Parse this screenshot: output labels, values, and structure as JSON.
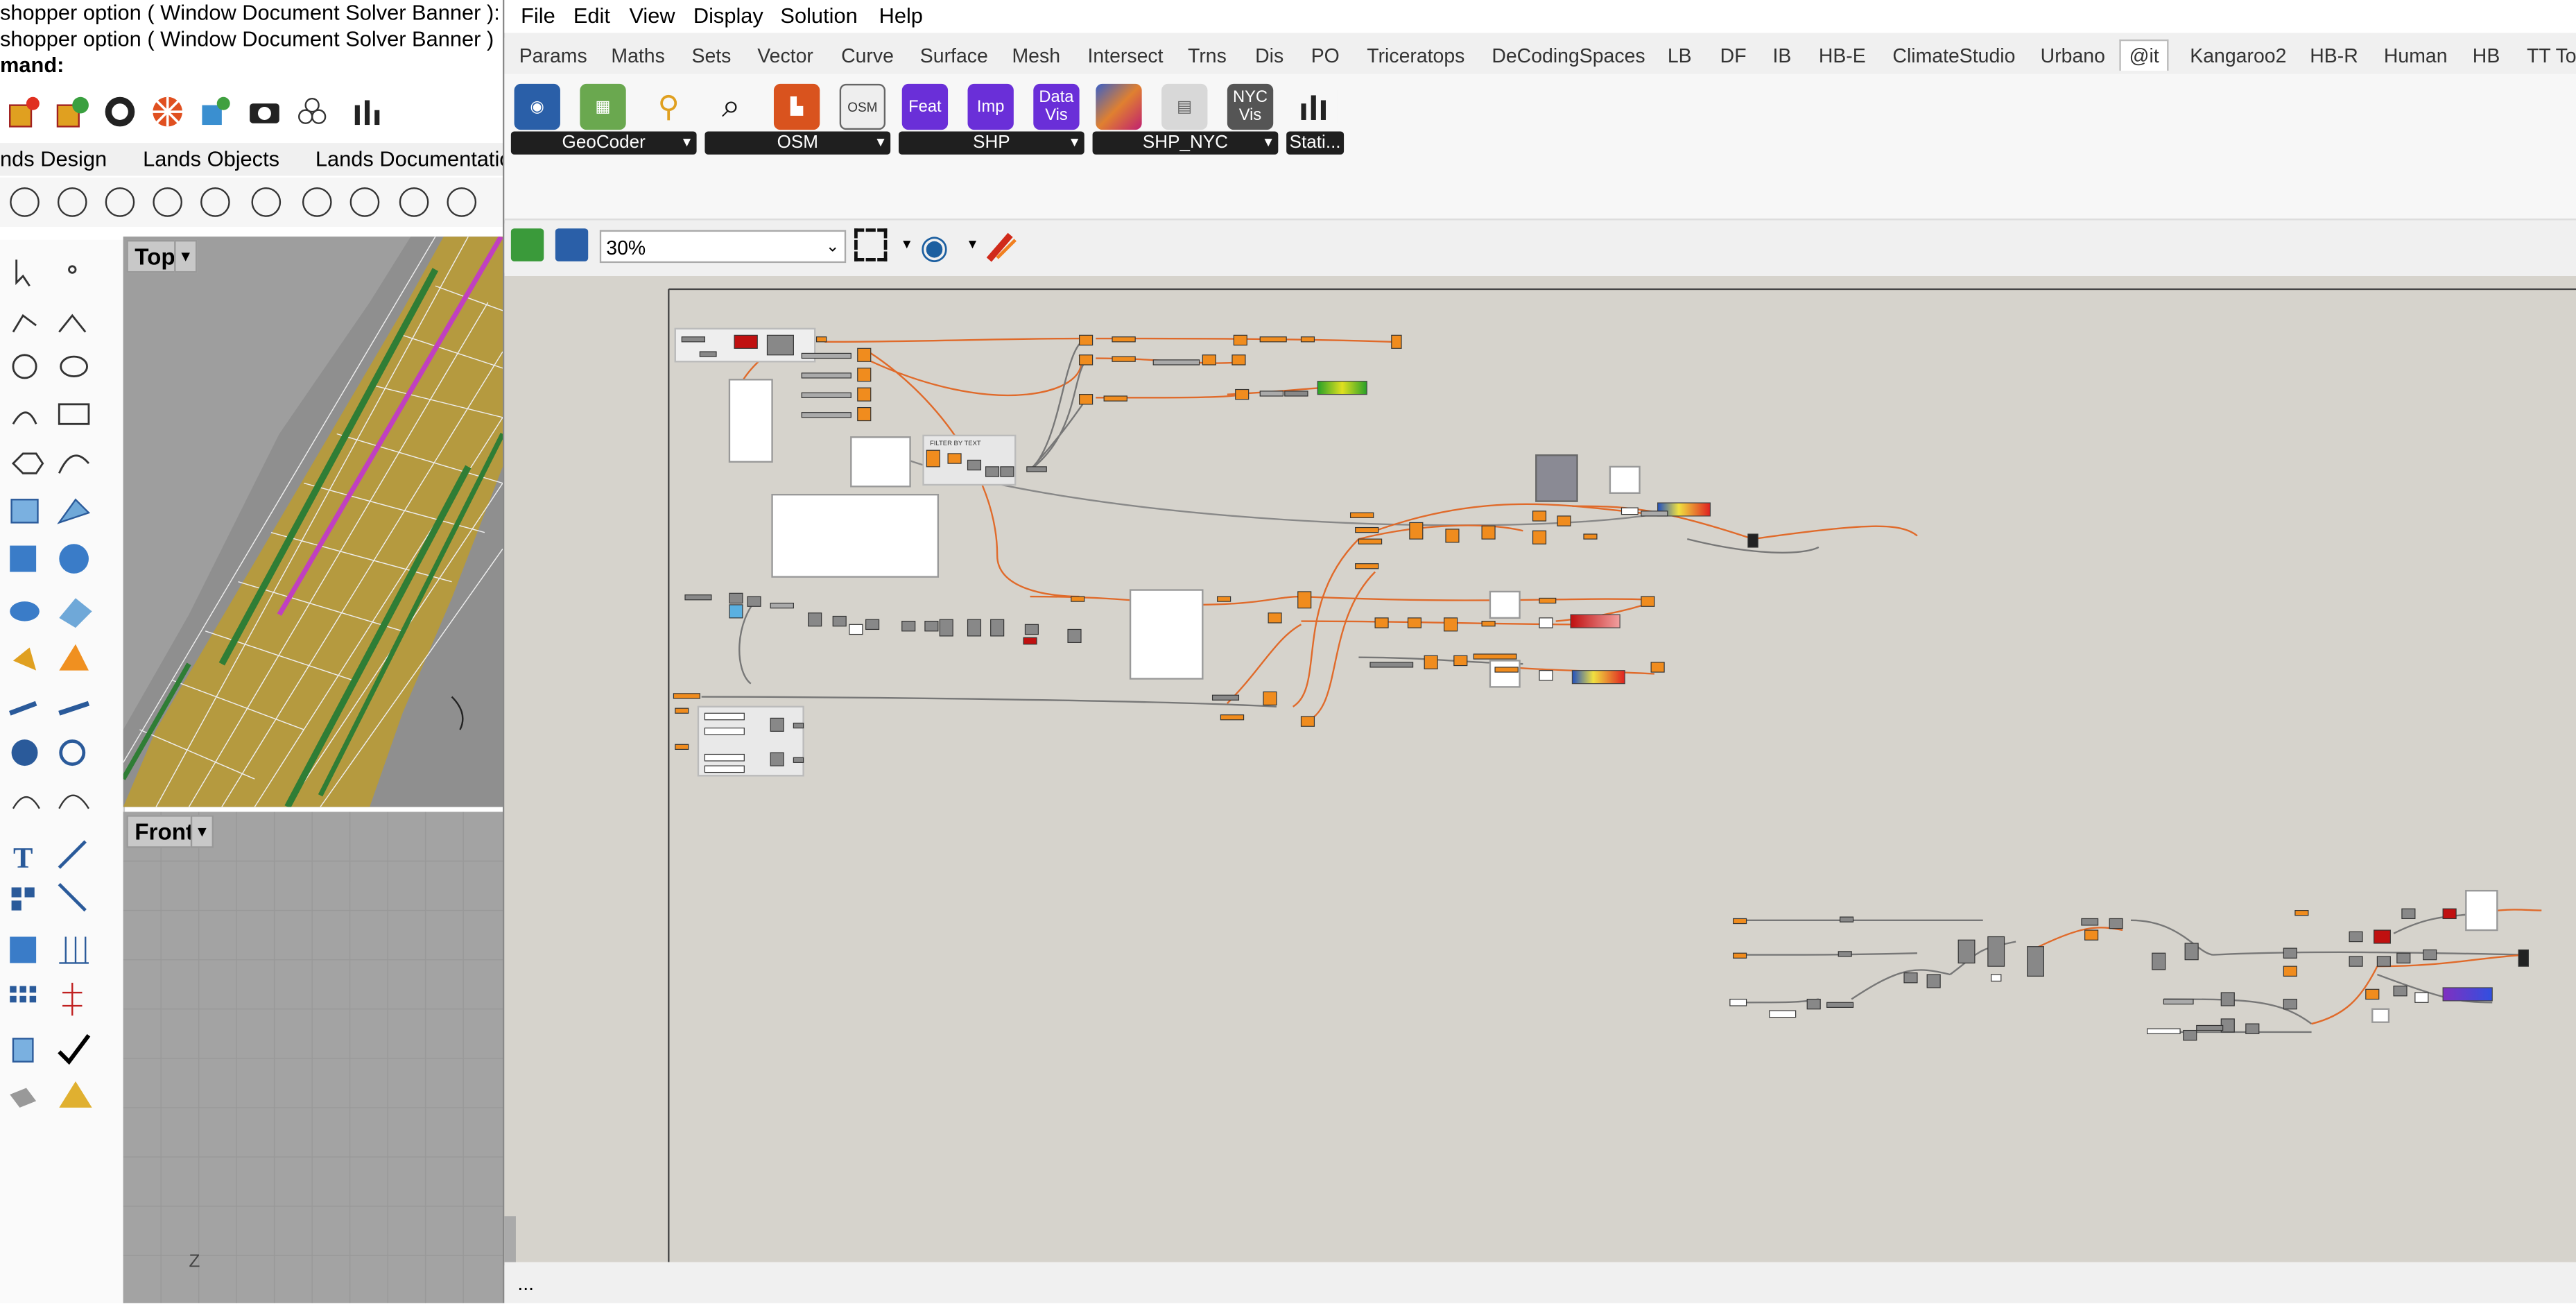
{
  "rhino": {
    "command_lines": [
      "shopper option ( Window  Document  Solver  Banner ):",
      "shopper option ( Window  Document  Solver  Banner )",
      "mand:"
    ],
    "tabs": [
      "nds Design",
      "Lands Objects",
      "Lands Documentatio"
    ],
    "viewports": {
      "top": "Top",
      "front": "Front"
    },
    "axis_label": "Z"
  },
  "gh": {
    "menu": [
      "File",
      "Edit",
      "View",
      "Display",
      "Solution",
      "Help"
    ],
    "tabs": [
      "Params",
      "Maths",
      "Sets",
      "Vector",
      "Curve",
      "Surface",
      "Mesh",
      "Intersect",
      "Trns",
      "Dis",
      "PO",
      "Triceratops",
      "DeCodingSpaces",
      "LB",
      "DF",
      "IB",
      "HB-E",
      "ClimateStudio",
      "Urbano",
      "@it",
      "Kangaroo2",
      "HB-R",
      "Human",
      "HB",
      "TT To"
    ],
    "active_tab": "@it",
    "ribbon_groups": [
      {
        "label": "GeoCoder",
        "buttons": [
          "globe-icon",
          "map-icon",
          "pin-icon"
        ]
      },
      {
        "label": "OSM",
        "buttons": [
          "search-icon",
          "building-icon",
          "osm-icon"
        ]
      },
      {
        "label": "SHP",
        "buttons": [
          "Feat",
          "Imp",
          "Data Vis"
        ]
      },
      {
        "label": "SHP_NYC",
        "buttons": [
          "palette-icon",
          "layers-icon",
          "NYC Vis"
        ]
      },
      {
        "label": "Stati...",
        "buttons": [
          "bar-chart-icon"
        ]
      }
    ],
    "zoom": "30%",
    "group_label": "FILTER BY TEXT",
    "status": "...",
    "colors": {
      "wire": "#e06a2a",
      "component": "#f08c1e",
      "canvas": "#d6d3cc"
    }
  }
}
